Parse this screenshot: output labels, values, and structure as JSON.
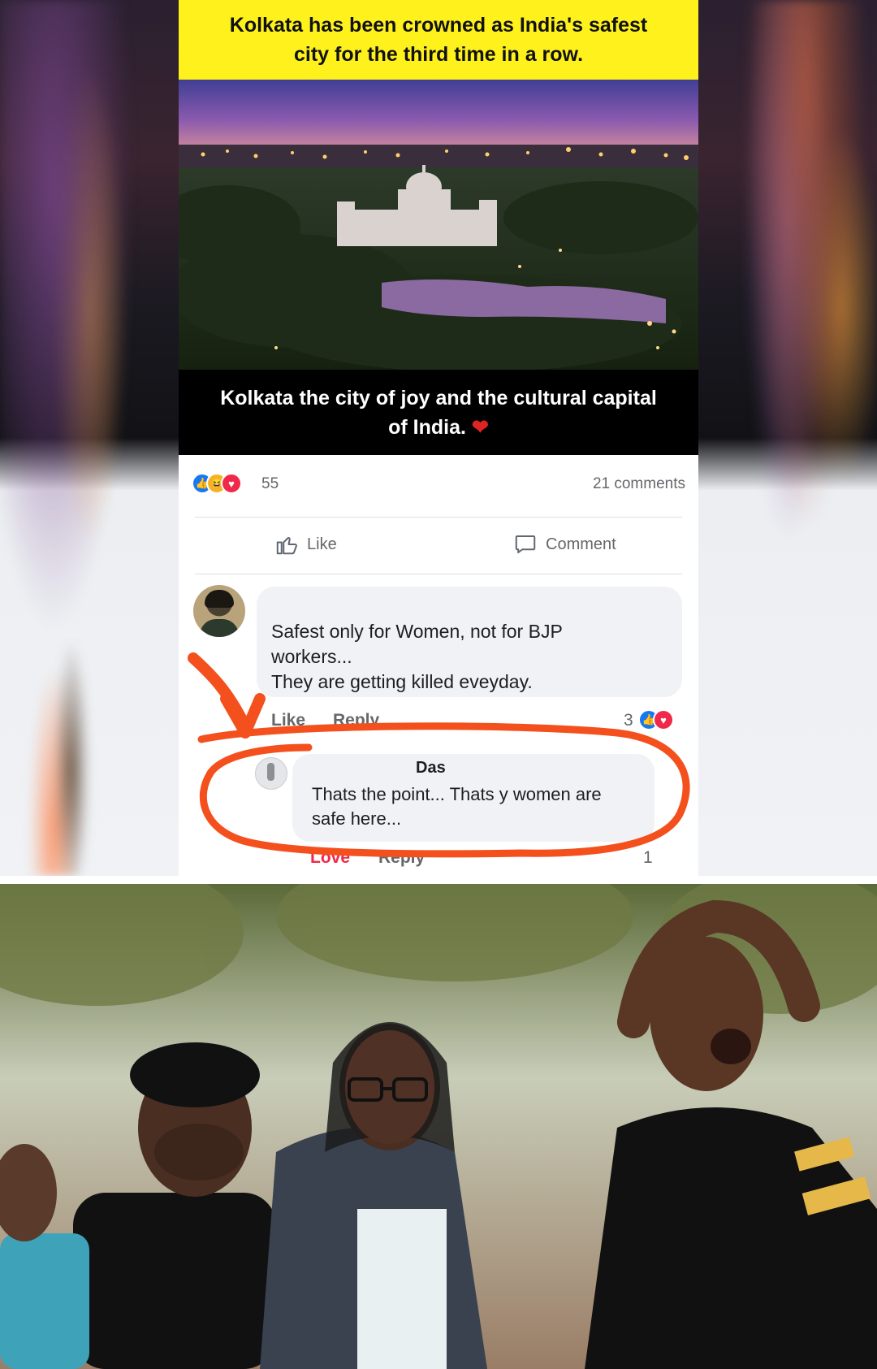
{
  "post": {
    "headline": "Kolkata has been crowned as India's safest city for the third time in a row.",
    "caption": "Kolkata the city of joy and the cultural capital of India.",
    "caption_emoji": "❤",
    "reaction_count": "55",
    "comments_count": "21 comments",
    "like_label": "Like",
    "comment_label": "Comment"
  },
  "comments": [
    {
      "text_lines": [
        "Safest only for Women, not for BJP",
        "workers...",
        "They are getting killed eveyday."
      ],
      "like_label": "Like",
      "reply_label": "Reply",
      "reaction_count": "3"
    }
  ],
  "reply": {
    "author": "Das",
    "text_lines": [
      "Thats the point... Thats y women are",
      "safe here..."
    ],
    "love_label": "Love",
    "reply_label": "Reply",
    "reaction_count": "1"
  },
  "colors": {
    "highlight_yellow": "#fff21c",
    "annotation_orange": "#f4501e",
    "facebook_blue": "#1877f2",
    "love_red": "#f02849"
  }
}
